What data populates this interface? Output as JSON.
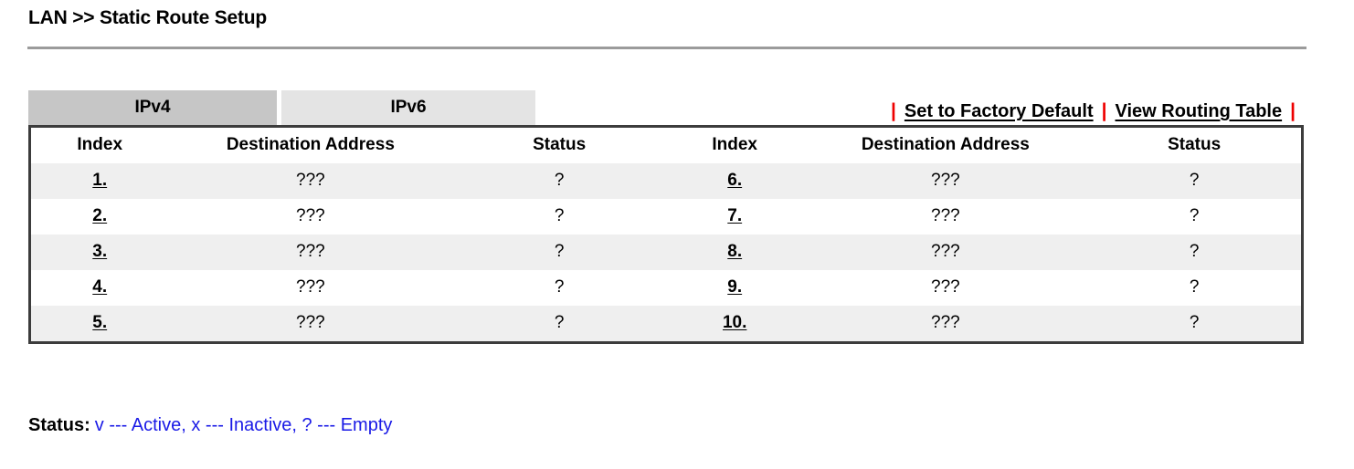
{
  "page": {
    "title": "LAN >> Static Route Setup"
  },
  "tabs": [
    {
      "id": "ipv4",
      "label": "IPv4",
      "active": true
    },
    {
      "id": "ipv6",
      "label": "IPv6",
      "active": false
    }
  ],
  "actions": {
    "separator": "|",
    "separator_color": "#ee0000",
    "links": [
      {
        "id": "set-to-factory-default",
        "label": "Set to Factory Default"
      },
      {
        "id": "view-routing-table",
        "label": "View Routing Table"
      }
    ]
  },
  "table": {
    "headers": [
      "Index",
      "Destination Address",
      "Status",
      "Index",
      "Destination Address",
      "Status"
    ],
    "rows": [
      {
        "shaded": true,
        "cells": [
          "1.",
          "???",
          "?",
          "6.",
          "???",
          "?"
        ]
      },
      {
        "shaded": false,
        "cells": [
          "2.",
          "???",
          "?",
          "7.",
          "???",
          "?"
        ]
      },
      {
        "shaded": true,
        "cells": [
          "3.",
          "???",
          "?",
          "8.",
          "???",
          "?"
        ]
      },
      {
        "shaded": false,
        "cells": [
          "4.",
          "???",
          "?",
          "9.",
          "???",
          "?"
        ]
      },
      {
        "shaded": true,
        "cells": [
          "5.",
          "???",
          "?",
          "10.",
          "???",
          "?"
        ]
      }
    ]
  },
  "legend": {
    "label": "Status:",
    "text": "v --- Active, x --- Inactive, ? --- Empty",
    "text_color": "#1a1ae6"
  }
}
